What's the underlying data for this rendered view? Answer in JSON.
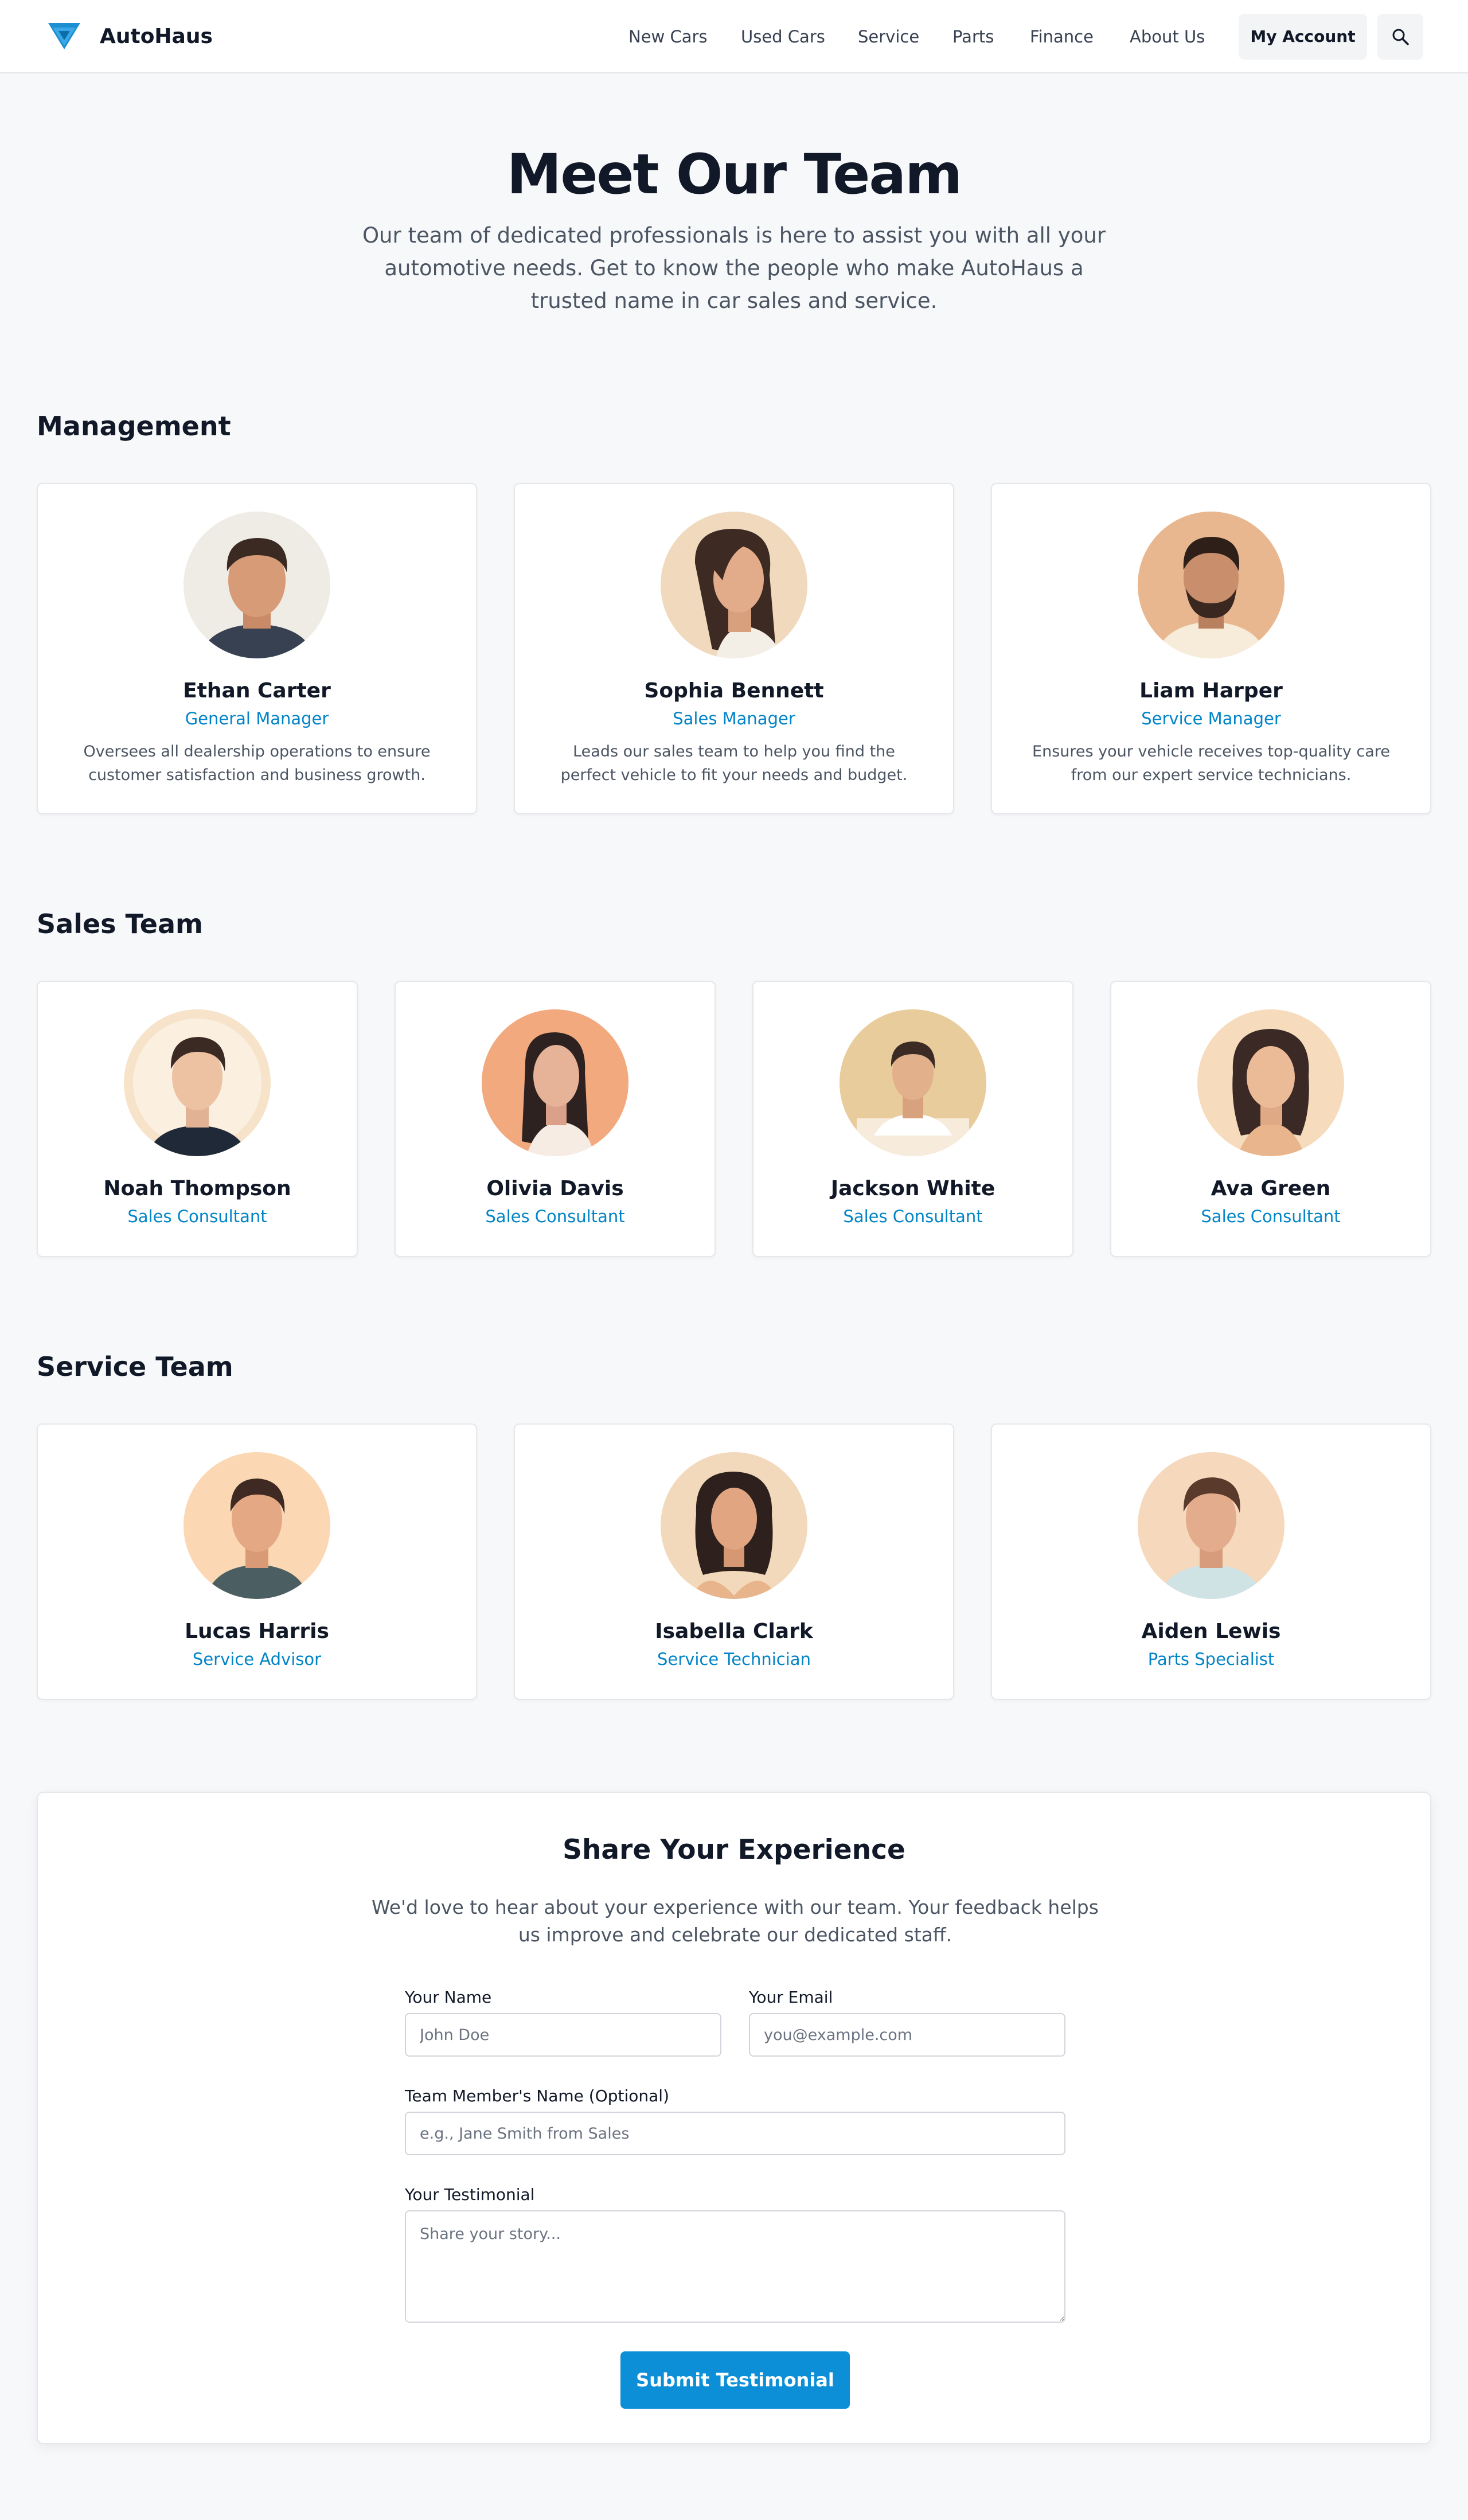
{
  "header": {
    "brand": "AutoHaus",
    "nav": [
      "New Cars",
      "Used Cars",
      "Service",
      "Parts",
      "Finance",
      "About Us"
    ],
    "account_label": "My Account"
  },
  "hero": {
    "title": "Meet Our Team",
    "text": "Our team of dedicated professionals is here to assist you with all your automotive needs. Get to know the people who make AutoHaus a trusted name in car sales and service."
  },
  "management": {
    "title": "Management",
    "members": [
      {
        "name": "Ethan Carter",
        "role": "General Manager",
        "desc": "Oversees all dealership operations to ensure customer satisfaction and business growth."
      },
      {
        "name": "Sophia Bennett",
        "role": "Sales Manager",
        "desc": "Leads our sales team to help you find the perfect vehicle to fit your needs and budget."
      },
      {
        "name": "Liam Harper",
        "role": "Service Manager",
        "desc": "Ensures your vehicle receives top-quality care from our expert service technicians."
      }
    ]
  },
  "sales": {
    "title": "Sales Team",
    "members": [
      {
        "name": "Noah Thompson",
        "role": "Sales Consultant"
      },
      {
        "name": "Olivia Davis",
        "role": "Sales Consultant"
      },
      {
        "name": "Jackson White",
        "role": "Sales Consultant"
      },
      {
        "name": "Ava Green",
        "role": "Sales Consultant"
      }
    ]
  },
  "service": {
    "title": "Service Team",
    "members": [
      {
        "name": "Lucas Harris",
        "role": "Service Advisor"
      },
      {
        "name": "Isabella Clark",
        "role": "Service Technician"
      },
      {
        "name": "Aiden Lewis",
        "role": "Parts Specialist"
      }
    ]
  },
  "form": {
    "title": "Share Your Experience",
    "intro": "We'd love to hear about your experience with our team. Your feedback helps us improve and celebrate our dedicated staff.",
    "name_label": "Your Name",
    "name_placeholder": "John Doe",
    "email_label": "Your Email",
    "email_placeholder": "you@example.com",
    "member_label": "Team Member's Name (Optional)",
    "member_placeholder": "e.g., Jane Smith from Sales",
    "testimonial_label": "Your Testimonial",
    "testimonial_placeholder": "Share your story...",
    "submit_label": "Submit Testimonial"
  },
  "colors": {
    "accent": "#0284c7",
    "button": "#0c8fd6",
    "background": "#f7f8fa"
  },
  "icons": [
    "autohaus-logo-icon",
    "search-icon"
  ]
}
